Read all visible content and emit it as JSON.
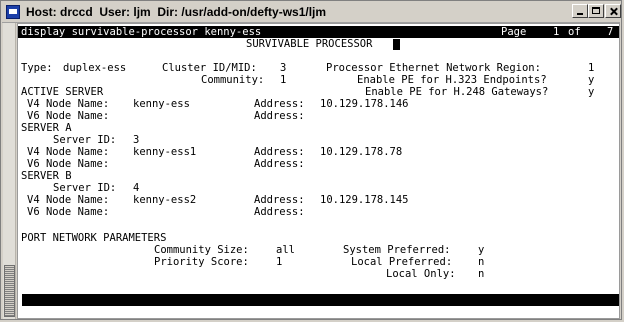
{
  "window": {
    "title": "Host: drccd  User: ljm  Dir: /usr/add-on/defty-ws1/ljm",
    "icon": "terminal-app-icon"
  },
  "terminal": {
    "command": "display survivable-processor kenny-ess",
    "page_label": "Page",
    "page_current": "1",
    "page_of": "of",
    "page_total": "7",
    "screen_title": "SURVIVABLE PROCESSOR",
    "type_label": "Type:",
    "type_value": "duplex-ess",
    "cluster_label": "Cluster ID/MID:",
    "cluster_value": "3",
    "pe_region_label": "Processor Ethernet Network Region:",
    "pe_region_value": "1",
    "community_label": "Community:",
    "community_value": "1",
    "pe_h323_label": "Enable PE for H.323 Endpoints?",
    "pe_h323_value": "y",
    "active_server_heading": "ACTIVE SERVER",
    "pe_h248_label": "Enable PE for H.248 Gateways?",
    "pe_h248_value": "y",
    "active_v4_label": "V4 Node Name:",
    "active_v4_value": "kenny-ess",
    "active_v4_addr_label": "Address:",
    "active_v4_addr_value": "10.129.178.146",
    "active_v6_label": "V6 Node Name:",
    "active_v6_addr_label": "Address:",
    "server_a_heading": "SERVER A",
    "server_a_id_label": "Server ID:",
    "server_a_id_value": "3",
    "server_a_v4_label": "V4 Node Name:",
    "server_a_v4_value": "kenny-ess1",
    "server_a_v4_addr_label": "Address:",
    "server_a_v4_addr_value": "10.129.178.78",
    "server_a_v6_label": "V6 Node Name:",
    "server_a_v6_addr_label": "Address:",
    "server_b_heading": "SERVER B",
    "server_b_id_label": "Server ID:",
    "server_b_id_value": "4",
    "server_b_v4_label": "V4 Node Name:",
    "server_b_v4_value": "kenny-ess2",
    "server_b_v4_addr_label": "Address:",
    "server_b_v4_addr_value": "10.129.178.145",
    "server_b_v6_label": "V6 Node Name:",
    "server_b_v6_addr_label": "Address:",
    "pnp_heading": "PORT NETWORK PARAMETERS",
    "community_size_label": "Community Size:",
    "community_size_value": "all",
    "system_preferred_label": "System Preferred:",
    "system_preferred_value": "y",
    "priority_score_label": "Priority Score:",
    "priority_score_value": "1",
    "local_preferred_label": "Local Preferred:",
    "local_preferred_value": "n",
    "local_only_label": "Local Only:",
    "local_only_value": "n"
  },
  "colors": {
    "terminal_bg": "#ffffff",
    "terminal_fg": "#000000",
    "chrome": "#d4d0c8"
  }
}
